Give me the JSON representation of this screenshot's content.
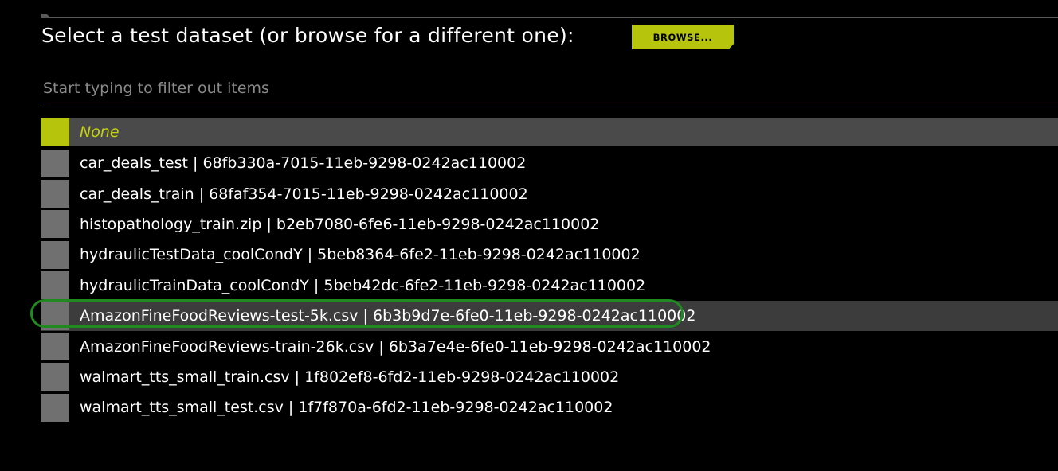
{
  "header": {
    "title": "Select a test dataset (or browse for a different one):",
    "browse_label": "BROWSE..."
  },
  "filter": {
    "placeholder": "Start typing to filter out items",
    "value": ""
  },
  "datasets": {
    "none_label": "None",
    "items": [
      {
        "label": "car_deals_test | 68fb330a-7015-11eb-9298-0242ac110002"
      },
      {
        "label": "car_deals_train | 68faf354-7015-11eb-9298-0242ac110002"
      },
      {
        "label": "histopathology_train.zip | b2eb7080-6fe6-11eb-9298-0242ac110002"
      },
      {
        "label": "hydraulicTestData_coolCondY | 5beb8364-6fe2-11eb-9298-0242ac110002"
      },
      {
        "label": "hydraulicTrainData_coolCondY | 5beb42dc-6fe2-11eb-9298-0242ac110002"
      },
      {
        "label": "AmazonFineFoodReviews-test-5k.csv | 6b3b9d7e-6fe0-11eb-9298-0242ac110002"
      },
      {
        "label": "AmazonFineFoodReviews-train-26k.csv | 6b3a7e4e-6fe0-11eb-9298-0242ac110002"
      },
      {
        "label": "walmart_tts_small_train.csv | 1f802ef8-6fd2-11eb-9298-0242ac110002"
      },
      {
        "label": "walmart_tts_small_test.csv | 1f7f870a-6fd2-11eb-9298-0242ac110002"
      }
    ]
  },
  "colors": {
    "accent": "#b6c40c",
    "background": "#000000",
    "checkbox": "#707070",
    "selected_row": "#4a4a4a",
    "highlight_ring": "#1f8a1f"
  }
}
